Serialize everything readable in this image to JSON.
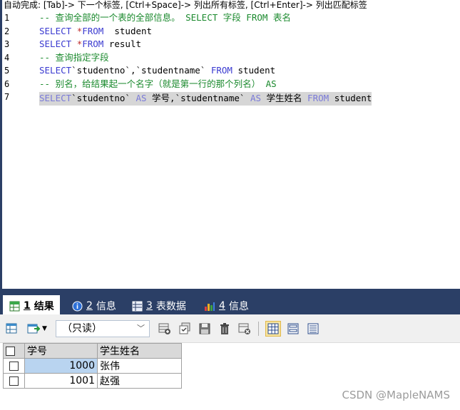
{
  "hint_bar": "自动完成: [Tab]-> 下一个标签, [Ctrl+Space]-> 列出所有标签, [Ctrl+Enter]-> 列出匹配标签",
  "editor": {
    "line_numbers": [
      "1",
      "2",
      "3",
      "4",
      "5",
      "6",
      "7"
    ],
    "lines": [
      [
        {
          "t": "-- 查询全部的一个表的全部信息。 SELECT 字段 FROM 表名",
          "c": "comment"
        }
      ],
      [
        {
          "t": "SELECT ",
          "c": "kw"
        },
        {
          "t": "*",
          "c": "op"
        },
        {
          "t": "FROM ",
          "c": "kw"
        },
        {
          "t": " student",
          "c": "text"
        }
      ],
      [
        {
          "t": "SELECT ",
          "c": "kw"
        },
        {
          "t": "*",
          "c": "op"
        },
        {
          "t": "FROM ",
          "c": "kw"
        },
        {
          "t": "result",
          "c": "text"
        }
      ],
      [
        {
          "t": "-- 查询指定字段",
          "c": "comment"
        }
      ],
      [
        {
          "t": "SELECT",
          "c": "kw"
        },
        {
          "t": "`studentno`,`studentname` ",
          "c": "text"
        },
        {
          "t": "FROM ",
          "c": "kw"
        },
        {
          "t": "student",
          "c": "text"
        }
      ],
      [
        {
          "t": "-- 别名，给结果起一个名字（就是第一行的那个列名） AS",
          "c": "comment"
        }
      ],
      [
        {
          "t": "SELECT",
          "c": "kw-sel"
        },
        {
          "t": "`studentno` ",
          "c": "text"
        },
        {
          "t": "AS ",
          "c": "kw-sel"
        },
        {
          "t": "学号,`studentname` ",
          "c": "text"
        },
        {
          "t": "AS ",
          "c": "kw-sel"
        },
        {
          "t": "学生姓名 ",
          "c": "text"
        },
        {
          "t": "FROM ",
          "c": "kw-sel"
        },
        {
          "t": "student",
          "c": "text"
        }
      ]
    ]
  },
  "tabs": [
    {
      "num": "1",
      "label": "结果",
      "icon": "result-grid-icon"
    },
    {
      "num": "2",
      "label": "信息",
      "icon": "info-icon"
    },
    {
      "num": "3",
      "label": "表数据",
      "icon": "table-data-icon"
    },
    {
      "num": "4",
      "label": "信息",
      "icon": "info-chart-icon"
    }
  ],
  "toolbar": {
    "readonly_label": "（只读）"
  },
  "grid": {
    "columns": [
      "学号",
      "学生姓名"
    ],
    "rows": [
      {
        "id": "1000",
        "name": "张伟"
      },
      {
        "id": "1001",
        "name": "赵强"
      }
    ]
  },
  "watermark": "CSDN @MapleNAMS",
  "colors": {
    "tab_bar": "#2b3f66",
    "comment": "#1b8a2e",
    "keyword": "#3a3ad0",
    "selection": "#d6d6d6",
    "selected_cell": "#b9d4f0"
  }
}
